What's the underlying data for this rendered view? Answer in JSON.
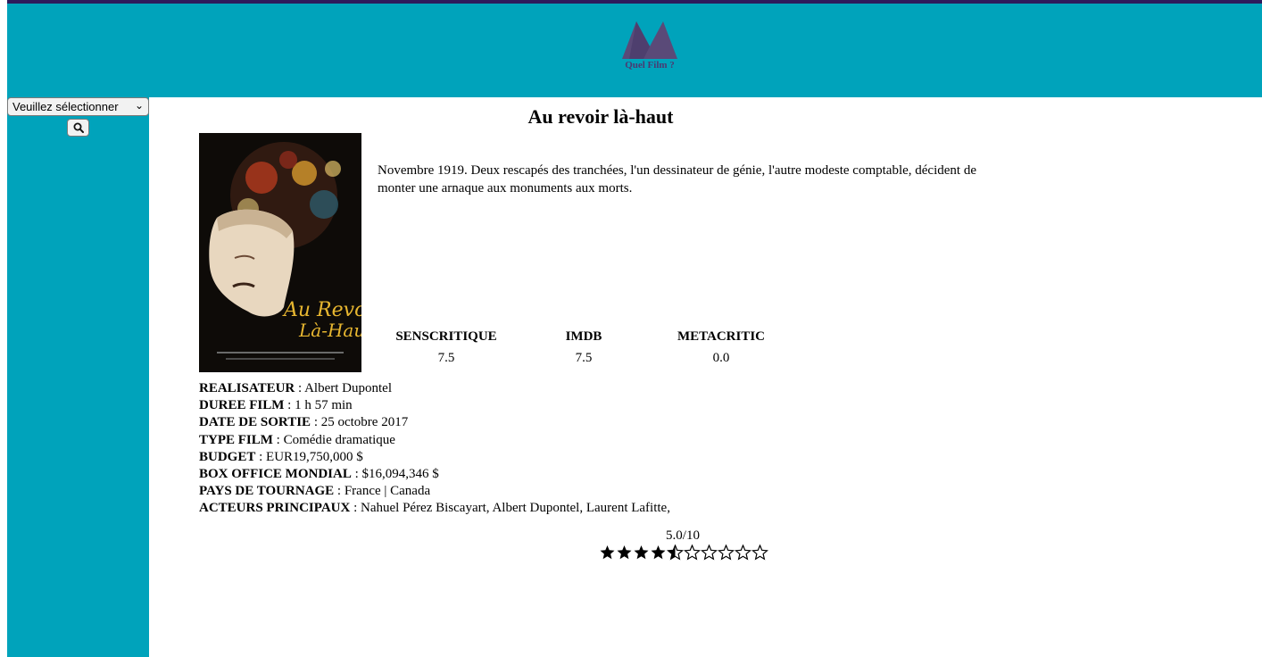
{
  "header": {
    "logo_text": "Quel Film ?",
    "background": "#00a3bb",
    "topbar_color": "#2e1a5c",
    "logo_color": "#5a4a78"
  },
  "sidebar": {
    "select_value": "Veuillez sélectionner",
    "search_icon": "search-icon"
  },
  "movie": {
    "title": "Au revoir là-haut",
    "synopsis": "Novembre 1919. Deux rescapés des tranchées, l'un dessinateur de génie, l'autre modeste comptable, décident de monter une arnaque aux monuments aux morts.",
    "poster_title_line1": "Au Revoir",
    "poster_title_line2": "Là-Haut",
    "ratings": [
      {
        "source": "SENSCRITIQUE",
        "value": "7.5"
      },
      {
        "source": "IMDB",
        "value": "7.5"
      },
      {
        "source": "METACRITIC",
        "value": "0.0"
      }
    ],
    "details": [
      {
        "label": "REALISATEUR",
        "value": "Albert Dupontel"
      },
      {
        "label": "DUREE FILM",
        "value": "1 h 57 min"
      },
      {
        "label": "DATE DE SORTIE",
        "value": "25 octobre 2017"
      },
      {
        "label": "TYPE FILM",
        "value": "Comédie dramatique"
      },
      {
        "label": "BUDGET",
        "value": "EUR19,750,000 $"
      },
      {
        "label": "BOX OFFICE MONDIAL",
        "value": "$16,094,346 $"
      },
      {
        "label": "PAYS DE TOURNAGE",
        "value": "France | Canada"
      },
      {
        "label": "ACTEURS PRINCIPAUX",
        "value": "Nahuel Pérez Biscayart, Albert Dupontel, Laurent Lafitte,"
      }
    ],
    "score_text": "5.0/10",
    "stars": {
      "filled": 4.5,
      "total": 10
    }
  }
}
